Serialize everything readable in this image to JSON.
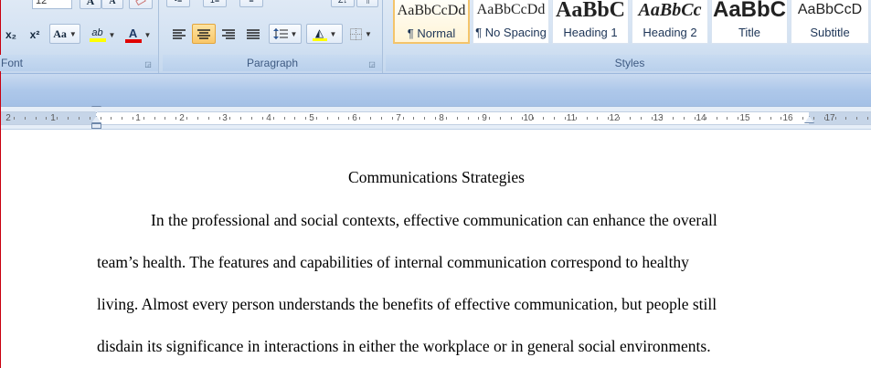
{
  "ribbon": {
    "font_group": {
      "label": "Font",
      "font_size_value": "12",
      "subscript_label": "x₂",
      "superscript_label": "x²",
      "change_case_label": "Aa",
      "highlight_label": "ab",
      "font_color_label": "A",
      "grow_font_label": "A",
      "shrink_font_label": "A",
      "highlight_color": "#ffff00",
      "font_color": "#e00000"
    },
    "paragraph_group": {
      "label": "Paragraph",
      "alignment_selected": "center"
    },
    "styles_group": {
      "label": "Styles",
      "items": [
        {
          "sample": "AaBbCcDd",
          "name": "¶ Normal",
          "selected": true
        },
        {
          "sample": "AaBbCcDd",
          "name": "¶ No Spacing",
          "selected": false
        },
        {
          "sample": "AaBbC",
          "name": "Heading 1",
          "selected": false
        },
        {
          "sample": "AaBbCc",
          "name": "Heading 2",
          "selected": false
        },
        {
          "sample": "AaBbC",
          "name": "Title",
          "selected": false
        },
        {
          "sample": "AaBbCcD",
          "name": "Subtitle",
          "selected": false
        }
      ]
    }
  },
  "ruler": {
    "numbers": [
      "2",
      "1",
      "1",
      "1",
      "2",
      "3",
      "4",
      "5",
      "6",
      "7",
      "8",
      "9",
      "10",
      "11",
      "12",
      "13",
      "14",
      "15",
      "16",
      "17"
    ]
  },
  "document": {
    "title": "Communications Strategies",
    "lines": [
      "In the professional and social contexts, effective communication can enhance the overall",
      "team’s health. The features and capabilities of internal communication correspond to healthy",
      "living. Almost every person understands the benefits of effective communication, but people still",
      "disdain its significance in interactions in either the workplace or in general social environments."
    ]
  }
}
